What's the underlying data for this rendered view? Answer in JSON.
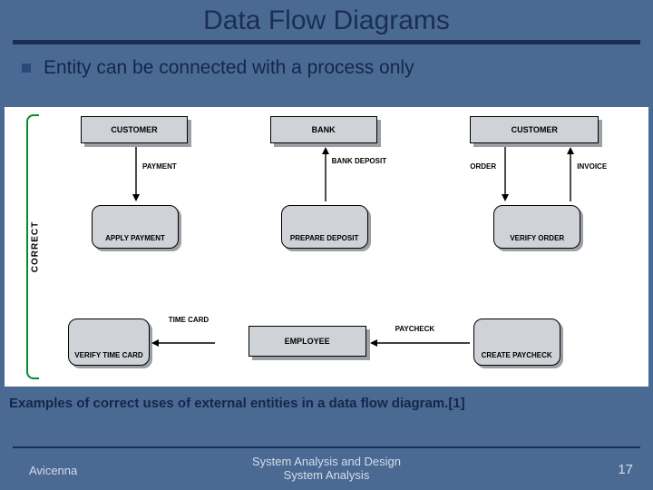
{
  "title": "Data Flow Diagrams",
  "bullet": "Entity can be connected with a process only",
  "correct_label": "CORRECT",
  "diagram": {
    "cells": {
      "r1c1": {
        "entity": "CUSTOMER",
        "flow": "PAYMENT",
        "process": "APPLY PAYMENT",
        "dir": "down"
      },
      "r1c2": {
        "entity": "BANK",
        "flow": "BANK DEPOSIT",
        "process": "PREPARE DEPOSIT",
        "dir": "up"
      },
      "r1c3": {
        "entity": "CUSTOMER",
        "flow1": "ORDER",
        "flow2": "INVOICE",
        "process": "VERIFY ORDER"
      },
      "r3c1": {
        "entity_right": "TIME CARD",
        "process": "VERIFY TIME CARD",
        "dir": "left"
      },
      "r3c2": {
        "entity": "EMPLOYEE",
        "flow": "PAYCHECK",
        "process": "CREATE PAYCHECK",
        "dir": "left_long"
      }
    }
  },
  "caption": "Examples of correct uses of external entities in a data flow diagram.[1]",
  "footer": {
    "left": "Avicenna",
    "center1": "System Analysis and Design",
    "center2": "System Analysis",
    "page": "17"
  }
}
